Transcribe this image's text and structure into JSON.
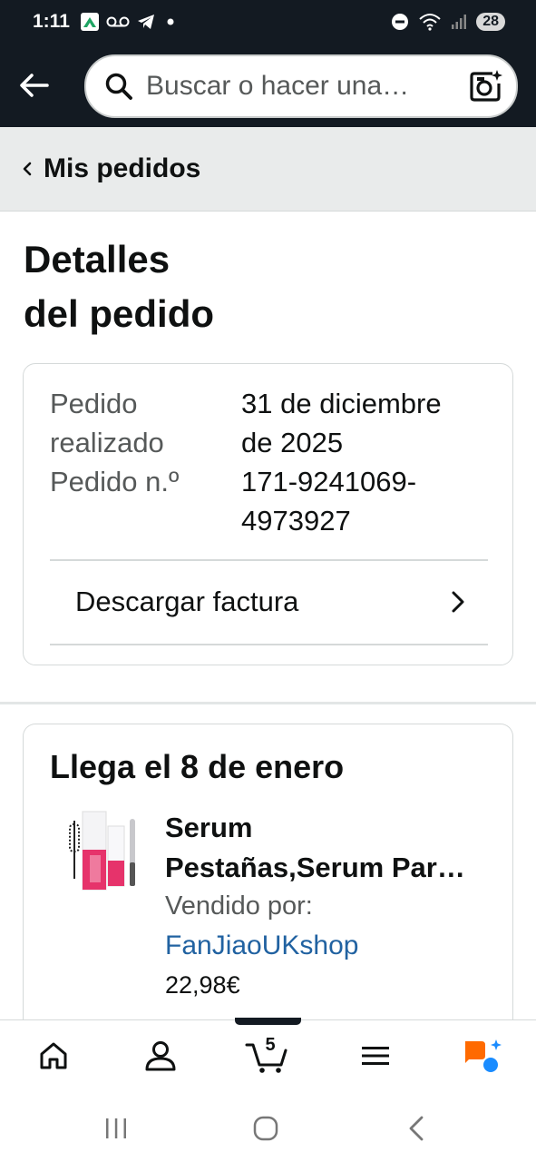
{
  "status_bar": {
    "time": "1:11",
    "battery": "28",
    "icons": [
      "app-notification-icon",
      "voicemail-icon",
      "telegram-icon",
      "dot-icon",
      "do-not-disturb-icon",
      "wifi-icon",
      "signal-icon"
    ]
  },
  "header": {
    "search_placeholder": "Buscar o hacer una…"
  },
  "breadcrumb": {
    "label": "Mis pedidos"
  },
  "page": {
    "title_line1": "Detalles",
    "title_line2": "del pedido"
  },
  "order_summary": {
    "placed_label_line1": "Pedido",
    "placed_label_line2": "realizado",
    "placed_value_line1": "31 de diciembre",
    "placed_value_line2": "de 2025",
    "number_label": "Pedido n.º",
    "number_value_line1": "171-9241069-",
    "number_value_line2": "4973927",
    "invoice_label": "Descargar factura"
  },
  "shipment": {
    "arrival": "Llega el 8 de enero",
    "product_title_line1": "Serum",
    "product_title_line2": "Pestañas,Serum Par…",
    "sold_by_label": "Vendido por:",
    "seller": "FanJiaoUKshop",
    "price": "22,98€"
  },
  "bottom_nav": {
    "cart_count": "5",
    "items": [
      "home",
      "account",
      "cart",
      "menu",
      "rufus"
    ]
  },
  "colors": {
    "header_bg": "#131a22",
    "link": "#2162a1",
    "rufus_orange": "#ff6a00",
    "rufus_blue": "#1a8cff"
  }
}
